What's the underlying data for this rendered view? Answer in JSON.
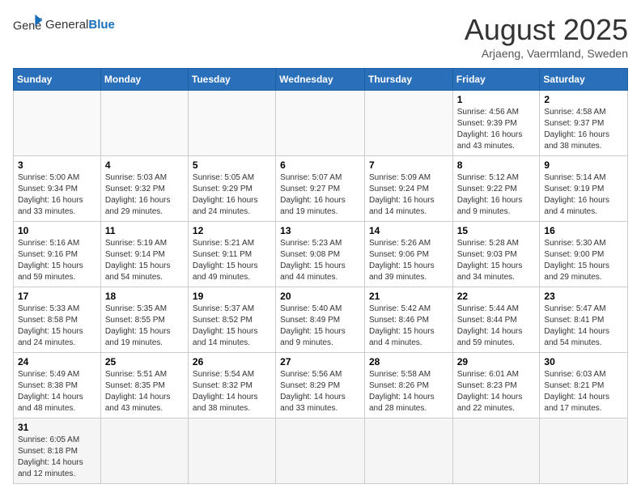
{
  "logo": {
    "text_general": "General",
    "text_blue": "Blue"
  },
  "header": {
    "month_year": "August 2025",
    "location": "Arjaeng, Vaermland, Sweden"
  },
  "weekdays": [
    "Sunday",
    "Monday",
    "Tuesday",
    "Wednesday",
    "Thursday",
    "Friday",
    "Saturday"
  ],
  "weeks": [
    [
      {
        "day": "",
        "info": ""
      },
      {
        "day": "",
        "info": ""
      },
      {
        "day": "",
        "info": ""
      },
      {
        "day": "",
        "info": ""
      },
      {
        "day": "",
        "info": ""
      },
      {
        "day": "1",
        "info": "Sunrise: 4:56 AM\nSunset: 9:39 PM\nDaylight: 16 hours and 43 minutes."
      },
      {
        "day": "2",
        "info": "Sunrise: 4:58 AM\nSunset: 9:37 PM\nDaylight: 16 hours and 38 minutes."
      }
    ],
    [
      {
        "day": "3",
        "info": "Sunrise: 5:00 AM\nSunset: 9:34 PM\nDaylight: 16 hours and 33 minutes."
      },
      {
        "day": "4",
        "info": "Sunrise: 5:03 AM\nSunset: 9:32 PM\nDaylight: 16 hours and 29 minutes."
      },
      {
        "day": "5",
        "info": "Sunrise: 5:05 AM\nSunset: 9:29 PM\nDaylight: 16 hours and 24 minutes."
      },
      {
        "day": "6",
        "info": "Sunrise: 5:07 AM\nSunset: 9:27 PM\nDaylight: 16 hours and 19 minutes."
      },
      {
        "day": "7",
        "info": "Sunrise: 5:09 AM\nSunset: 9:24 PM\nDaylight: 16 hours and 14 minutes."
      },
      {
        "day": "8",
        "info": "Sunrise: 5:12 AM\nSunset: 9:22 PM\nDaylight: 16 hours and 9 minutes."
      },
      {
        "day": "9",
        "info": "Sunrise: 5:14 AM\nSunset: 9:19 PM\nDaylight: 16 hours and 4 minutes."
      }
    ],
    [
      {
        "day": "10",
        "info": "Sunrise: 5:16 AM\nSunset: 9:16 PM\nDaylight: 15 hours and 59 minutes."
      },
      {
        "day": "11",
        "info": "Sunrise: 5:19 AM\nSunset: 9:14 PM\nDaylight: 15 hours and 54 minutes."
      },
      {
        "day": "12",
        "info": "Sunrise: 5:21 AM\nSunset: 9:11 PM\nDaylight: 15 hours and 49 minutes."
      },
      {
        "day": "13",
        "info": "Sunrise: 5:23 AM\nSunset: 9:08 PM\nDaylight: 15 hours and 44 minutes."
      },
      {
        "day": "14",
        "info": "Sunrise: 5:26 AM\nSunset: 9:06 PM\nDaylight: 15 hours and 39 minutes."
      },
      {
        "day": "15",
        "info": "Sunrise: 5:28 AM\nSunset: 9:03 PM\nDaylight: 15 hours and 34 minutes."
      },
      {
        "day": "16",
        "info": "Sunrise: 5:30 AM\nSunset: 9:00 PM\nDaylight: 15 hours and 29 minutes."
      }
    ],
    [
      {
        "day": "17",
        "info": "Sunrise: 5:33 AM\nSunset: 8:58 PM\nDaylight: 15 hours and 24 minutes."
      },
      {
        "day": "18",
        "info": "Sunrise: 5:35 AM\nSunset: 8:55 PM\nDaylight: 15 hours and 19 minutes."
      },
      {
        "day": "19",
        "info": "Sunrise: 5:37 AM\nSunset: 8:52 PM\nDaylight: 15 hours and 14 minutes."
      },
      {
        "day": "20",
        "info": "Sunrise: 5:40 AM\nSunset: 8:49 PM\nDaylight: 15 hours and 9 minutes."
      },
      {
        "day": "21",
        "info": "Sunrise: 5:42 AM\nSunset: 8:46 PM\nDaylight: 15 hours and 4 minutes."
      },
      {
        "day": "22",
        "info": "Sunrise: 5:44 AM\nSunset: 8:44 PM\nDaylight: 14 hours and 59 minutes."
      },
      {
        "day": "23",
        "info": "Sunrise: 5:47 AM\nSunset: 8:41 PM\nDaylight: 14 hours and 54 minutes."
      }
    ],
    [
      {
        "day": "24",
        "info": "Sunrise: 5:49 AM\nSunset: 8:38 PM\nDaylight: 14 hours and 48 minutes."
      },
      {
        "day": "25",
        "info": "Sunrise: 5:51 AM\nSunset: 8:35 PM\nDaylight: 14 hours and 43 minutes."
      },
      {
        "day": "26",
        "info": "Sunrise: 5:54 AM\nSunset: 8:32 PM\nDaylight: 14 hours and 38 minutes."
      },
      {
        "day": "27",
        "info": "Sunrise: 5:56 AM\nSunset: 8:29 PM\nDaylight: 14 hours and 33 minutes."
      },
      {
        "day": "28",
        "info": "Sunrise: 5:58 AM\nSunset: 8:26 PM\nDaylight: 14 hours and 28 minutes."
      },
      {
        "day": "29",
        "info": "Sunrise: 6:01 AM\nSunset: 8:23 PM\nDaylight: 14 hours and 22 minutes."
      },
      {
        "day": "30",
        "info": "Sunrise: 6:03 AM\nSunset: 8:21 PM\nDaylight: 14 hours and 17 minutes."
      }
    ],
    [
      {
        "day": "31",
        "info": "Sunrise: 6:05 AM\nSunset: 8:18 PM\nDaylight: 14 hours and 12 minutes."
      },
      {
        "day": "",
        "info": ""
      },
      {
        "day": "",
        "info": ""
      },
      {
        "day": "",
        "info": ""
      },
      {
        "day": "",
        "info": ""
      },
      {
        "day": "",
        "info": ""
      },
      {
        "day": "",
        "info": ""
      }
    ]
  ]
}
